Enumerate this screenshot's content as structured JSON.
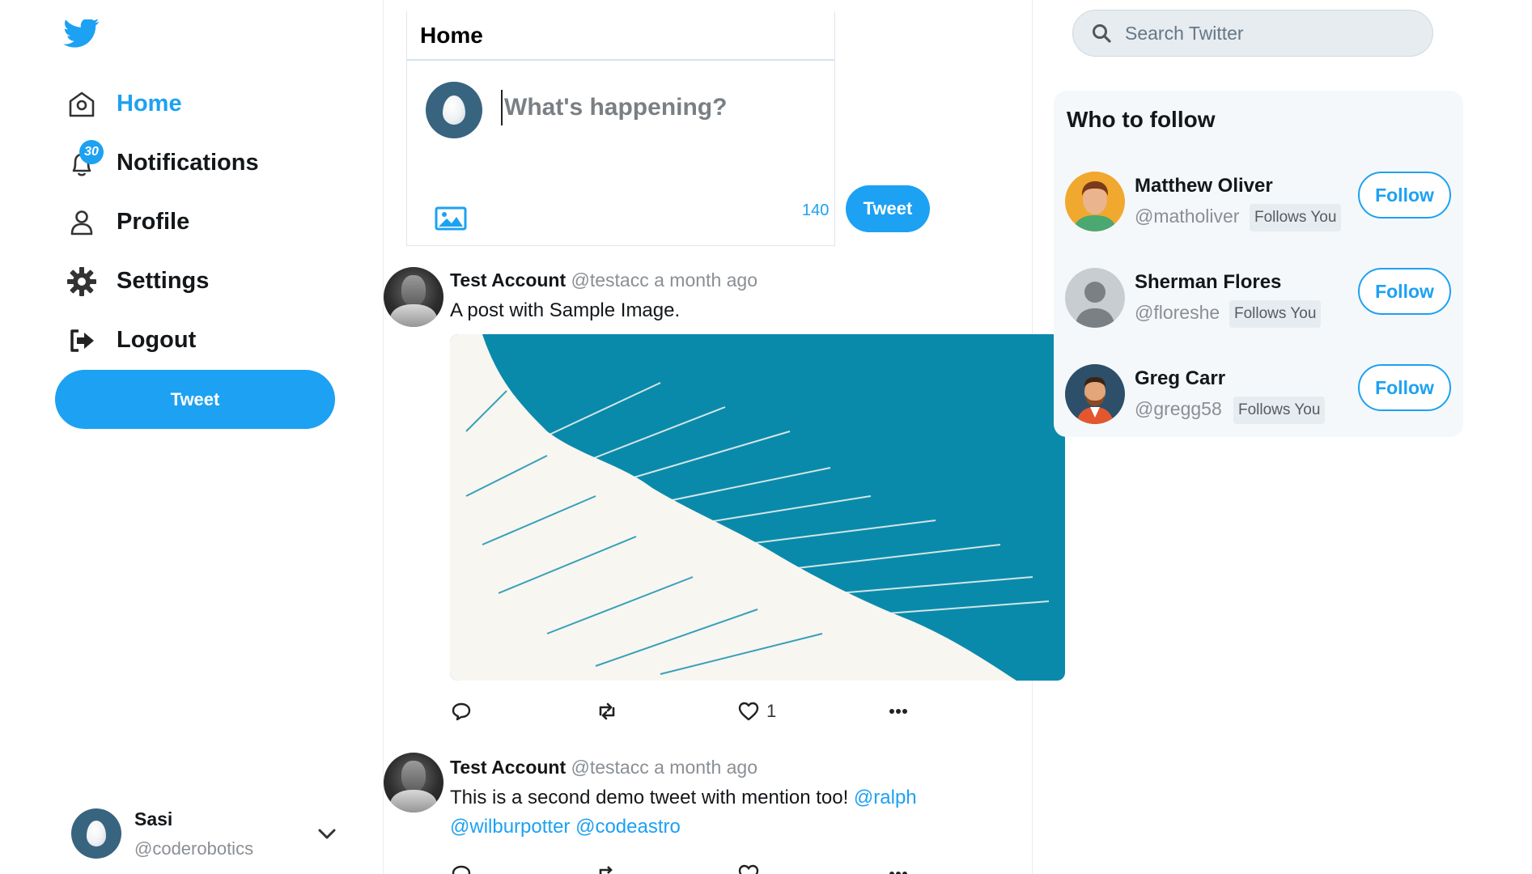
{
  "nav": {
    "items": [
      {
        "label": "Home",
        "icon": "home-icon",
        "active": true
      },
      {
        "label": "Notifications",
        "icon": "bell-icon",
        "badge": "30"
      },
      {
        "label": "Profile",
        "icon": "user-icon"
      },
      {
        "label": "Settings",
        "icon": "gear-icon"
      },
      {
        "label": "Logout",
        "icon": "logout-icon"
      }
    ],
    "tweet_button": "Tweet"
  },
  "account": {
    "name": "Sasi",
    "handle": "@coderobotics"
  },
  "home": {
    "title": "Home",
    "compose_placeholder": "What's happening?",
    "char_count": "140",
    "tweet_button": "Tweet"
  },
  "tweets": [
    {
      "name": "Test Account",
      "handle": "@testacc",
      "time": "a month ago",
      "text": "A post with Sample Image.",
      "likes": "1"
    },
    {
      "name": "Test Account",
      "handle": "@testacc",
      "time": "a month ago",
      "text": "This is a second demo tweet with mention too!",
      "mentions": [
        "@ralph",
        "@wilburpotter",
        "@codeastro"
      ]
    }
  ],
  "search": {
    "placeholder": "Search Twitter"
  },
  "who_to_follow": {
    "title": "Who to follow",
    "users": [
      {
        "name": "Matthew Oliver",
        "handle": "@matholiver",
        "follows_you": "Follows You",
        "button": "Follow"
      },
      {
        "name": "Sherman Flores",
        "handle": "@floreshe",
        "follows_you": "Follows You",
        "button": "Follow"
      },
      {
        "name": "Greg Carr",
        "handle": "@gregg58",
        "follows_you": "Follows You",
        "button": "Follow"
      }
    ]
  },
  "colors": {
    "accent": "#1da1f2",
    "image_teal": "#0a8aab",
    "image_cream": "#f7f6f1"
  }
}
